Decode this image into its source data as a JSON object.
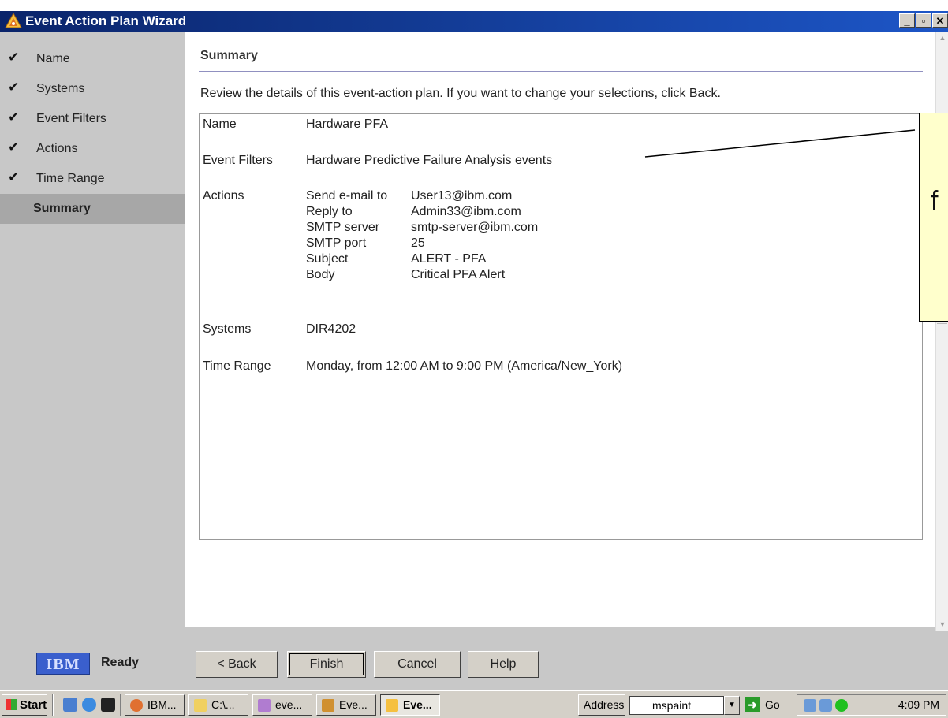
{
  "window": {
    "title": "Event Action Plan Wizard"
  },
  "nav": [
    {
      "label": "Name",
      "checked": true
    },
    {
      "label": "Systems",
      "checked": true
    },
    {
      "label": "Event Filters",
      "checked": true
    },
    {
      "label": "Actions",
      "checked": true
    },
    {
      "label": "Time Range",
      "checked": true
    },
    {
      "label": "Summary",
      "checked": false,
      "active": true
    }
  ],
  "content": {
    "title": "Summary",
    "instructions": "Review the details of this event-action plan. If you want to change your selections, click Back.",
    "summary": {
      "name_label": "Name",
      "name_value": "Hardware PFA",
      "filters_label": "Event Filters",
      "filters_value": "Hardware Predictive Failure Analysis events",
      "actions_label": "Actions",
      "actions": [
        {
          "label": "Send e-mail to",
          "value": "User13@ibm.com"
        },
        {
          "label": "Reply to",
          "value": "Admin33@ibm.com"
        },
        {
          "label": "SMTP server",
          "value": "smtp-server@ibm.com"
        },
        {
          "label": "SMTP port",
          "value": "25"
        },
        {
          "label": "Subject",
          "value": "ALERT - PFA"
        },
        {
          "label": "Body",
          "value": "Critical PFA Alert"
        }
      ],
      "systems_label": "Systems",
      "systems_value": "DIR4202",
      "time_label": "Time Range",
      "time_value": "Monday, from 12:00 AM to 9:00 PM (America/New_York)"
    }
  },
  "callout": {
    "text": "f"
  },
  "status": {
    "logo": "IBM",
    "text": "Ready"
  },
  "buttons": {
    "back": "< Back",
    "finish": "Finish",
    "cancel": "Cancel",
    "help": "Help"
  },
  "taskbar": {
    "start": "Start",
    "tasks": [
      "IBM...",
      "C:\\...",
      "eve...",
      "Eve...",
      "Eve..."
    ],
    "address_label": "Address",
    "address_value": "mspaint",
    "go": "Go",
    "clock": "4:09 PM"
  }
}
